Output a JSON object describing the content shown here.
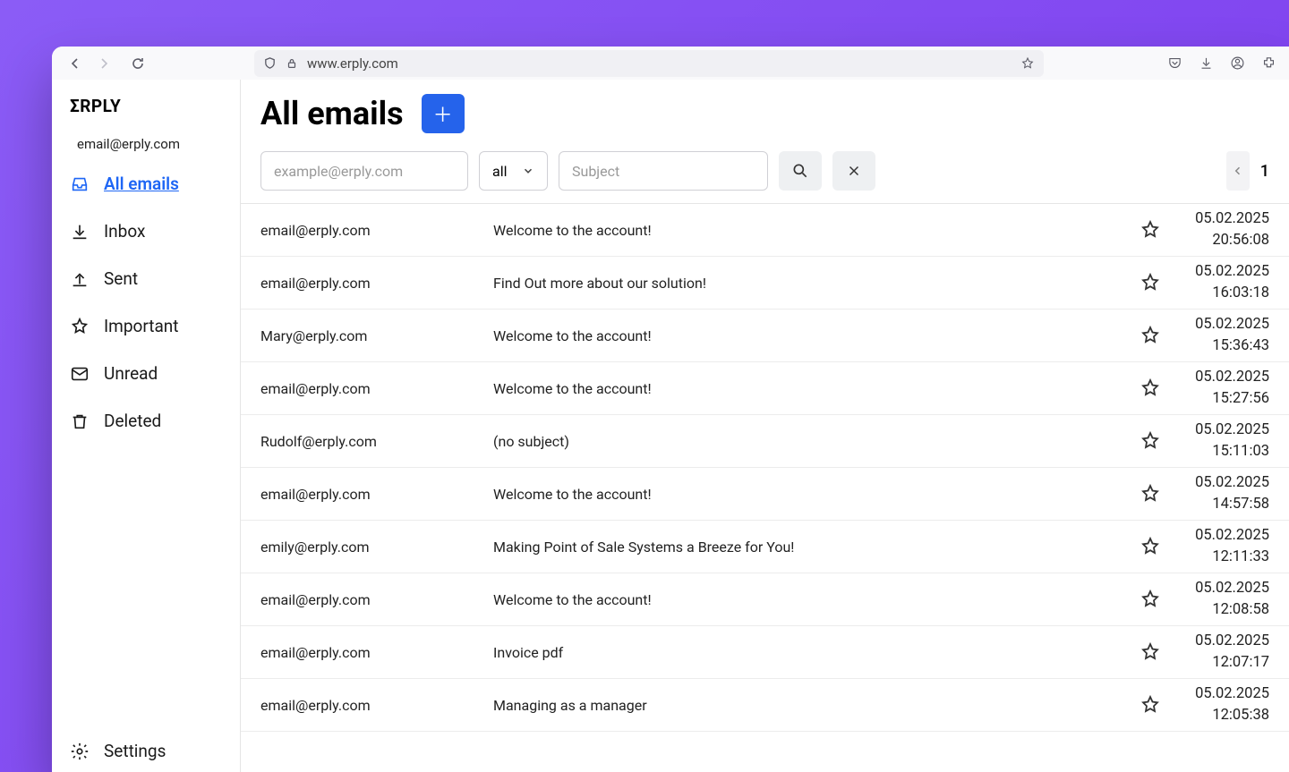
{
  "browser": {
    "url": "www.erply.com"
  },
  "sidebar": {
    "logo": "ΣRPLY",
    "account_email": "email@erply.com",
    "items": [
      {
        "label": "All emails"
      },
      {
        "label": "Inbox"
      },
      {
        "label": "Sent"
      },
      {
        "label": "Important"
      },
      {
        "label": "Unread"
      },
      {
        "label": "Deleted"
      }
    ],
    "settings_label": "Settings"
  },
  "header": {
    "title": "All emails",
    "add_label": "＋"
  },
  "toolbar": {
    "email_placeholder": "example@erply.com",
    "filter_value": "all",
    "subject_placeholder": "Subject",
    "page": "1"
  },
  "emails": [
    {
      "from": "email@erply.com",
      "subject": "Welcome to the account!",
      "date": "05.02.2025",
      "time": "20:56:08"
    },
    {
      "from": "email@erply.com",
      "subject": "Find Out more about our solution!",
      "date": "05.02.2025",
      "time": "16:03:18"
    },
    {
      "from": "Mary@erply.com",
      "subject": "Welcome to the account!",
      "date": "05.02.2025",
      "time": "15:36:43"
    },
    {
      "from": "email@erply.com",
      "subject": "Welcome to the account!",
      "date": "05.02.2025",
      "time": "15:27:56"
    },
    {
      "from": "Rudolf@erply.com",
      "subject": "(no subject)",
      "date": "05.02.2025",
      "time": "15:11:03"
    },
    {
      "from": "email@erply.com",
      "subject": "Welcome to the account!",
      "date": "05.02.2025",
      "time": "14:57:58"
    },
    {
      "from": "emily@erply.com",
      "subject": "Making Point of Sale Systems a Breeze for You!",
      "date": "05.02.2025",
      "time": "12:11:33"
    },
    {
      "from": "email@erply.com",
      "subject": "Welcome to the account!",
      "date": "05.02.2025",
      "time": "12:08:58"
    },
    {
      "from": "email@erply.com",
      "subject": "Invoice pdf",
      "date": "05.02.2025",
      "time": "12:07:17"
    },
    {
      "from": "email@erply.com",
      "subject": "Managing as a manager",
      "date": "05.02.2025",
      "time": "12:05:38"
    }
  ]
}
